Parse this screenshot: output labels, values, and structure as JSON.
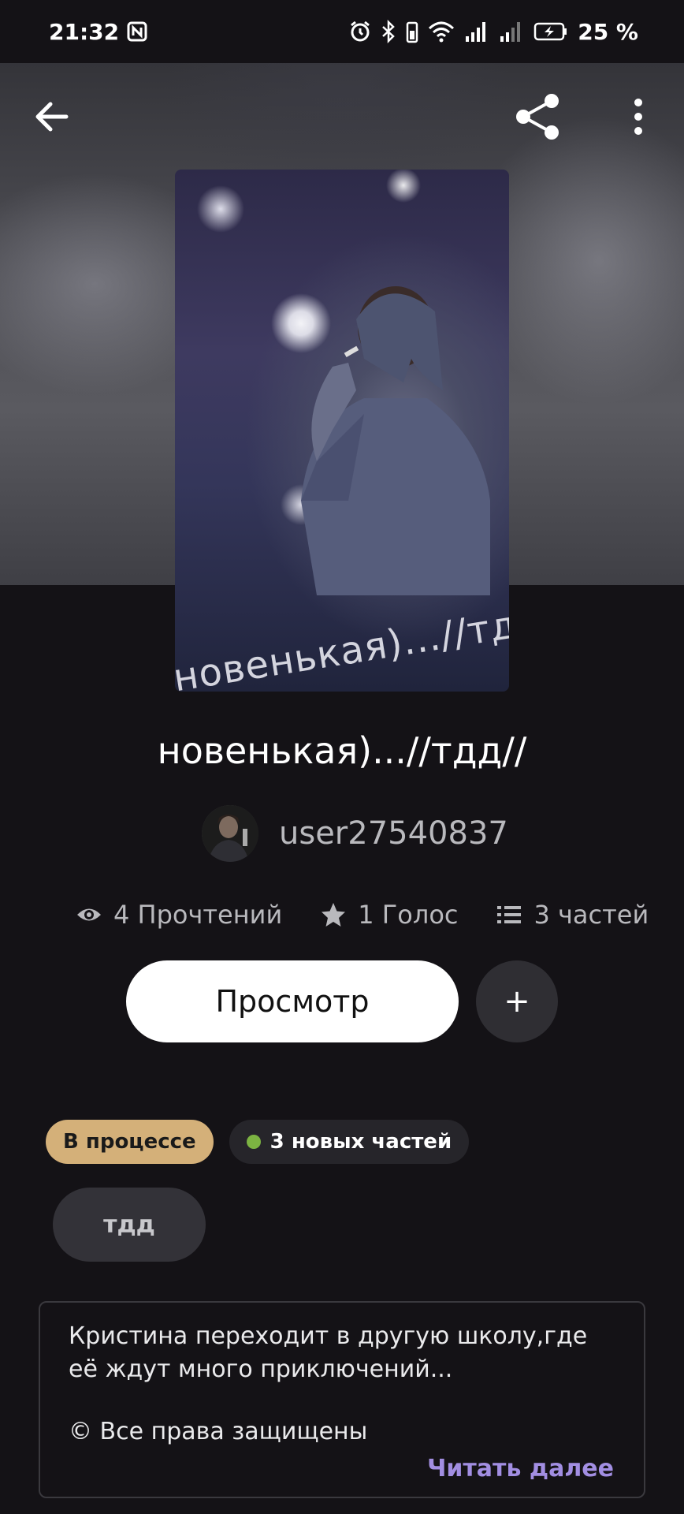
{
  "status_bar": {
    "time": "21:32",
    "battery": "25 %"
  },
  "app_bar": {
    "back_icon": "arrow-left-icon",
    "share_icon": "share-icon",
    "more_icon": "more-vertical-icon"
  },
  "story": {
    "cover_text": "новенькая)...//тдд",
    "title": "новенькая)...//тдд//",
    "author": "user27540837",
    "stats": {
      "reads": "4 Прочтений",
      "votes": "1 Голос",
      "parts": "3 частей"
    },
    "view_button": "Просмотр",
    "add_button": "+",
    "badges": {
      "status": "В процессе",
      "new_parts": "3 новых частей"
    },
    "tags": [
      "тдд"
    ],
    "description": "Кристина переходит в другую школу,где её ждут много приключений...",
    "copyright": "© Все права защищены",
    "read_more": "Читать далее"
  },
  "colors": {
    "background": "#141216",
    "status_badge": "#d4b079",
    "new_parts_dot": "#7cb342",
    "read_more": "#a28ee2"
  }
}
